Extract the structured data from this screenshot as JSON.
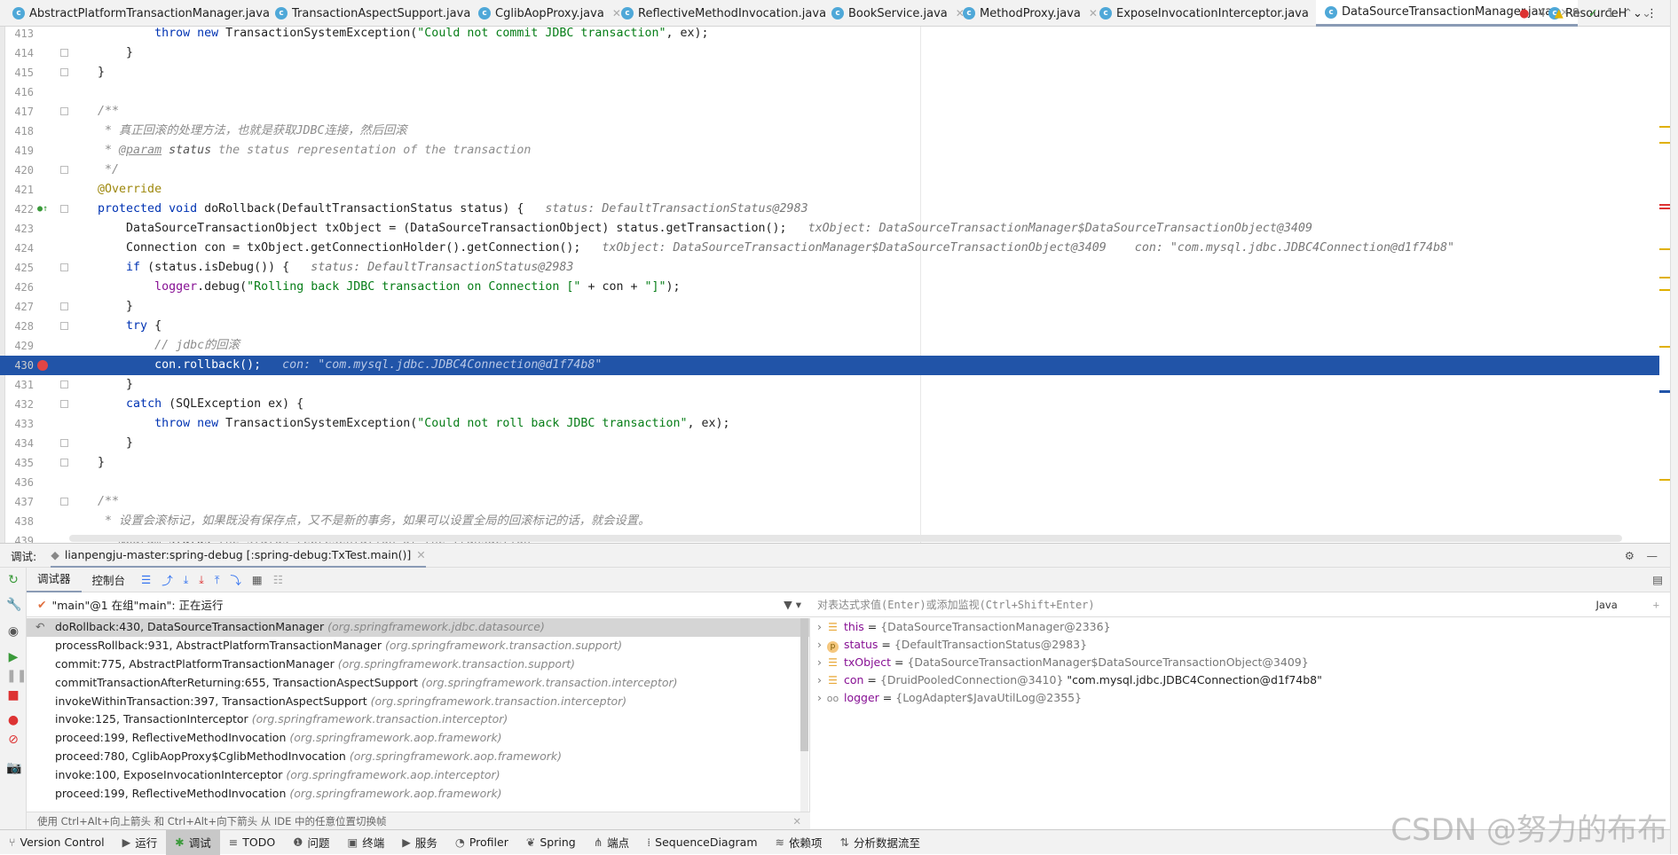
{
  "tabs": [
    {
      "label": "AbstractPlatformTransactionManager.java",
      "active": false
    },
    {
      "label": "TransactionAspectSupport.java",
      "active": false
    },
    {
      "label": "CglibAopProxy.java",
      "active": false
    },
    {
      "label": "ReflectiveMethodInvocation.java",
      "active": false
    },
    {
      "label": "BookService.java",
      "active": false
    },
    {
      "label": "MethodProxy.java",
      "active": false
    },
    {
      "label": "ExposeInvocationInterceptor.java",
      "active": false
    },
    {
      "label": "DataSourceTransactionManager.java",
      "active": true
    },
    {
      "label": "ResourceH",
      "active": false
    }
  ],
  "inspections": {
    "errors": "4",
    "warnings": "8",
    "weak": "1"
  },
  "code_lines": [
    {
      "n": "413",
      "t": [
        [
          "            ",
          ""
        ],
        [
          "throw new ",
          "kw"
        ],
        [
          "TransactionSystemException(",
          ""
        ],
        [
          "\"Could not commit JDBC transaction\"",
          "str"
        ],
        [
          ", ex);",
          ""
        ]
      ]
    },
    {
      "n": "414",
      "t": [
        [
          "        }",
          ""
        ]
      ]
    },
    {
      "n": "415",
      "t": [
        [
          "    }",
          ""
        ]
      ]
    },
    {
      "n": "416",
      "t": []
    },
    {
      "n": "417",
      "t": [
        [
          "    /**",
          "cm"
        ]
      ]
    },
    {
      "n": "418",
      "t": [
        [
          "     * 真正回滚的处理方法，也就是获取JDBC连接，然后回滚",
          "cm"
        ]
      ]
    },
    {
      "n": "419",
      "t": [
        [
          "     * ",
          "cm"
        ],
        [
          "@param",
          "tag"
        ],
        [
          " status",
          "docb"
        ],
        [
          " the status representation of the transaction",
          "cm"
        ]
      ]
    },
    {
      "n": "420",
      "t": [
        [
          "     */",
          "cm"
        ]
      ]
    },
    {
      "n": "421",
      "t": [
        [
          "    @Override",
          "ann"
        ]
      ]
    },
    {
      "n": "422",
      "t": [
        [
          "    protected void ",
          "kw"
        ],
        [
          "doRollback(DefaultTransactionStatus status) {",
          ""
        ],
        [
          "   status: DefaultTransactionStatus@2983",
          "hint"
        ]
      ]
    },
    {
      "n": "423",
      "t": [
        [
          "        DataSourceTransactionObject txObject = (DataSourceTransactionObject) status.getTransaction();",
          ""
        ],
        [
          "   txObject: DataSourceTransactionManager$DataSourceTransactionObject@3409",
          "hint"
        ]
      ]
    },
    {
      "n": "424",
      "t": [
        [
          "        Connection con = txObject.getConnectionHolder().getConnection();",
          ""
        ],
        [
          "   txObject: DataSourceTransactionManager$DataSourceTransactionObject@3409    con: \"com.mysql.jdbc.JDBC4Connection@d1f74b8\"",
          "hint"
        ]
      ]
    },
    {
      "n": "425",
      "t": [
        [
          "        ",
          ""
        ],
        [
          "if",
          "kw"
        ],
        [
          " (status.isDebug()) {",
          ""
        ],
        [
          "   status: DefaultTransactionStatus@2983",
          "hint"
        ]
      ]
    },
    {
      "n": "426",
      "t": [
        [
          "            ",
          ""
        ],
        [
          "logger",
          "fld"
        ],
        [
          ".debug(",
          ""
        ],
        [
          "\"Rolling back JDBC transaction on Connection [\"",
          "str"
        ],
        [
          " + con + ",
          ""
        ],
        [
          "\"]\"",
          "str"
        ],
        [
          ");",
          ""
        ]
      ]
    },
    {
      "n": "427",
      "t": [
        [
          "        }",
          ""
        ]
      ]
    },
    {
      "n": "428",
      "t": [
        [
          "        ",
          ""
        ],
        [
          "try",
          "kw"
        ],
        [
          " {",
          ""
        ]
      ]
    },
    {
      "n": "429",
      "t": [
        [
          "            // jdbc的回滚",
          "cm"
        ]
      ]
    },
    {
      "n": "430",
      "t": [
        [
          "            con.rollback();",
          ""
        ],
        [
          "   con: \"com.mysql.jdbc.JDBC4Connection@d1f74b8\"",
          "hint"
        ]
      ],
      "current": true
    },
    {
      "n": "431",
      "t": [
        [
          "        }",
          ""
        ]
      ]
    },
    {
      "n": "432",
      "t": [
        [
          "        ",
          ""
        ],
        [
          "catch",
          "kw"
        ],
        [
          " (SQLException ex) {",
          ""
        ]
      ]
    },
    {
      "n": "433",
      "t": [
        [
          "            ",
          ""
        ],
        [
          "throw new ",
          "kw"
        ],
        [
          "TransactionSystemException(",
          ""
        ],
        [
          "\"Could not roll back JDBC transaction\"",
          "str"
        ],
        [
          ", ex);",
          ""
        ]
      ]
    },
    {
      "n": "434",
      "t": [
        [
          "        }",
          ""
        ]
      ]
    },
    {
      "n": "435",
      "t": [
        [
          "    }",
          ""
        ]
      ]
    },
    {
      "n": "436",
      "t": []
    },
    {
      "n": "437",
      "t": [
        [
          "    /**",
          "cm"
        ]
      ]
    },
    {
      "n": "438",
      "t": [
        [
          "     * 设置会滚标记，如果既没有保存点，又不是新的事务，如果可以设置全局的回滚标记的话，就会设置。",
          "cm"
        ]
      ]
    },
    {
      "n": "439",
      "t": [
        [
          "     * ",
          "cm"
        ],
        [
          "@param",
          "tag"
        ],
        [
          " status",
          "docb"
        ],
        [
          " the status representation of the transaction",
          "cm"
        ]
      ]
    }
  ],
  "debug": {
    "label": "调试:",
    "session": "lianpengju-master:spring-debug [:spring-debug:TxTest.main()]",
    "tab_debugger": "调试器",
    "tab_console": "控制台",
    "thread": "\"main\"@1 在组\"main\": 正在运行",
    "eval_placeholder": "对表达式求值(Enter)或添加监视(Ctrl+Shift+Enter)",
    "lang": "Java",
    "hint": "使用 Ctrl+Alt+向上箭头 和 Ctrl+Alt+向下箭头 从 IDE 中的任意位置切换帧",
    "frames": [
      {
        "m": "doRollback:430, DataSourceTransactionManager",
        "p": "(org.springframework.jdbc.datasource)"
      },
      {
        "m": "processRollback:931, AbstractPlatformTransactionManager",
        "p": "(org.springframework.transaction.support)"
      },
      {
        "m": "commit:775, AbstractPlatformTransactionManager",
        "p": "(org.springframework.transaction.support)"
      },
      {
        "m": "commitTransactionAfterReturning:655, TransactionAspectSupport",
        "p": "(org.springframework.transaction.interceptor)"
      },
      {
        "m": "invokeWithinTransaction:397, TransactionAspectSupport",
        "p": "(org.springframework.transaction.interceptor)"
      },
      {
        "m": "invoke:125, TransactionInterceptor",
        "p": "(org.springframework.transaction.interceptor)"
      },
      {
        "m": "proceed:199, ReflectiveMethodInvocation",
        "p": "(org.springframework.aop.framework)"
      },
      {
        "m": "proceed:780, CglibAopProxy$CglibMethodInvocation",
        "p": "(org.springframework.aop.framework)"
      },
      {
        "m": "invoke:100, ExposeInvocationInterceptor",
        "p": "(org.springframework.aop.interceptor)"
      },
      {
        "m": "proceed:199, ReflectiveMethodInvocation",
        "p": "(org.springframework.aop.framework)"
      }
    ],
    "variables": [
      {
        "name": "this",
        "value": "{DataSourceTransactionManager@2336}",
        "str": "",
        "icon": "field"
      },
      {
        "name": "status",
        "value": "{DefaultTransactionStatus@2983}",
        "str": "",
        "icon": "parameter"
      },
      {
        "name": "txObject",
        "value": "{DataSourceTransactionManager$DataSourceTransactionObject@3409}",
        "str": "",
        "icon": "field"
      },
      {
        "name": "con",
        "value": "{DruidPooledConnection@3410}",
        "str": "\"com.mysql.jdbc.JDBC4Connection@d1f74b8\"",
        "icon": "field"
      },
      {
        "name": "logger",
        "value": "{LogAdapter$JavaUtilLog@2355}",
        "str": "",
        "icon": "watch"
      }
    ]
  },
  "statusbar": [
    {
      "label": "Version Control",
      "icon": "branch"
    },
    {
      "label": "运行",
      "icon": "play"
    },
    {
      "label": "调试",
      "icon": "bug",
      "active": true
    },
    {
      "label": "TODO",
      "icon": "list"
    },
    {
      "label": "问题",
      "icon": "alert"
    },
    {
      "label": "终端",
      "icon": "terminal"
    },
    {
      "label": "服务",
      "icon": "services"
    },
    {
      "label": "Profiler",
      "icon": "profiler"
    },
    {
      "label": "Spring",
      "icon": "leaf"
    },
    {
      "label": "端点",
      "icon": "endpoints"
    },
    {
      "label": "SequenceDiagram",
      "icon": "sequence"
    },
    {
      "label": "依赖项",
      "icon": "layers"
    },
    {
      "label": "分析数据流至",
      "icon": "dataflow"
    }
  ],
  "watermark": "CSDN @努力的布布",
  "colors": {
    "current_line": "#2154a8",
    "keyword": "#0033b3",
    "string": "#067d17"
  }
}
